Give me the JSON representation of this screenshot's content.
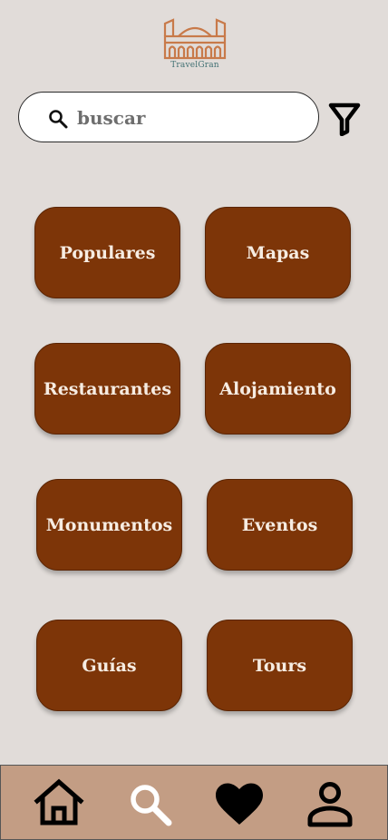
{
  "app": {
    "logo_text": "TravelGran"
  },
  "search": {
    "placeholder": "buscar",
    "value": ""
  },
  "categories": [
    {
      "label": "Populares"
    },
    {
      "label": "Mapas"
    },
    {
      "label": "Restaurantes"
    },
    {
      "label": "Alojamiento"
    },
    {
      "label": "Monumentos"
    },
    {
      "label": "Eventos"
    },
    {
      "label": "Guías"
    },
    {
      "label": "Tours"
    }
  ],
  "colors": {
    "background": "#e1dcd9",
    "card": "#7d3508",
    "card_text": "#f6ece2",
    "nav_bar": "#c39d84",
    "logo": "#c87a4a"
  },
  "icons": {
    "search": "search-icon",
    "filter": "filter-icon",
    "home": "home-icon",
    "explore": "search-icon",
    "favorites": "heart-icon",
    "profile": "person-icon"
  }
}
